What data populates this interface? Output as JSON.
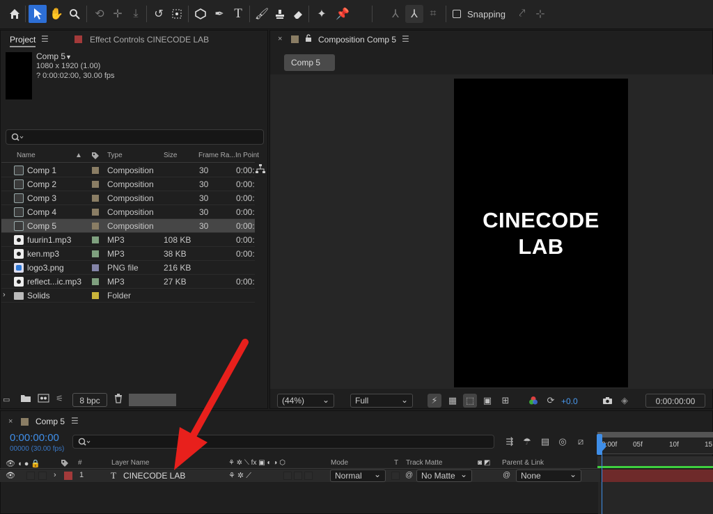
{
  "toolbar": {
    "snapping_label": "Snapping",
    "icons": [
      "home-icon",
      "selection-tool-icon",
      "hand-tool-icon",
      "zoom-tool-icon",
      "orbit-camera-icon",
      "pan-camera-icon",
      "dolly-camera-icon",
      "rotate-tool-icon",
      "pan-behind-icon",
      "shape-tool-icon",
      "pen-tool-icon",
      "type-tool-icon",
      "brush-tool-icon",
      "clone-stamp-icon",
      "eraser-icon",
      "roto-brush-icon",
      "puppet-pin-icon"
    ]
  },
  "project_panel": {
    "tab_label": "Project",
    "effect_controls_label": "Effect Controls CINECODE LAB",
    "preview": {
      "name": "Comp 5",
      "dimensions": "1080 x 1920 (1.00)",
      "duration": "? 0:00:02:00, 30.00 fps"
    },
    "search_placeholder": "",
    "columns": {
      "name": "Name",
      "type": "Type",
      "size": "Size",
      "frame_rate": "Frame Ra...",
      "in_point": "In Point"
    },
    "items": [
      {
        "name": "Comp 1",
        "type": "Composition",
        "size": "",
        "fps": "30",
        "in": "0:00:",
        "icon": "comp",
        "color": "#8a7d64"
      },
      {
        "name": "Comp 2",
        "type": "Composition",
        "size": "",
        "fps": "30",
        "in": "0:00:",
        "icon": "comp",
        "color": "#8a7d64"
      },
      {
        "name": "Comp 3",
        "type": "Composition",
        "size": "",
        "fps": "30",
        "in": "0:00:",
        "icon": "comp",
        "color": "#8a7d64"
      },
      {
        "name": "Comp 4",
        "type": "Composition",
        "size": "",
        "fps": "30",
        "in": "0:00:",
        "icon": "comp",
        "color": "#8a7d64"
      },
      {
        "name": "Comp 5",
        "type": "Composition",
        "size": "",
        "fps": "30",
        "in": "0:00:",
        "icon": "comp",
        "color": "#8a7d64",
        "selected": true
      },
      {
        "name": "fuurin1.mp3",
        "type": "MP3",
        "size": "108 KB",
        "fps": "",
        "in": "0:00:",
        "icon": "audio",
        "color": "#7fa07f"
      },
      {
        "name": "ken.mp3",
        "type": "MP3",
        "size": "38 KB",
        "fps": "",
        "in": "0:00:",
        "icon": "audio",
        "color": "#7fa07f"
      },
      {
        "name": "logo3.png",
        "type": "PNG file",
        "size": "216 KB",
        "fps": "",
        "in": "",
        "icon": "img",
        "color": "#8484a8"
      },
      {
        "name": "reflect...ic.mp3",
        "type": "MP3",
        "size": "27 KB",
        "fps": "",
        "in": "0:00:",
        "icon": "audio",
        "color": "#7fa07f"
      },
      {
        "name": "Solids",
        "type": "Folder",
        "size": "",
        "fps": "",
        "in": "",
        "icon": "folder",
        "color": "#c9b43a"
      }
    ],
    "bpc_label": "8 bpc"
  },
  "composition_panel": {
    "tab_label": "Composition Comp 5",
    "flow_tab": "Comp 5",
    "canvas_text_line1": "CINECODE",
    "canvas_text_line2": "LAB",
    "zoom": "(44%)",
    "resolution": "Full",
    "exposure": "+0.0",
    "timecode": "0:00:00:00"
  },
  "timeline_panel": {
    "tab_label": "Comp 5",
    "timecode": "0:00:00:00",
    "frames_fps": "00000 (30.00 fps)",
    "columns": {
      "num": "#",
      "layer_name": "Layer Name",
      "mode": "Mode",
      "t": "T",
      "track_matte": "Track Matte",
      "parent_link": "Parent & Link"
    },
    "ruler": [
      "0:00f",
      "05f",
      "10f",
      "15"
    ],
    "layers": [
      {
        "num": "1",
        "name": "CINECODE LAB",
        "mode": "Normal",
        "matte": "No Matte",
        "parent": "None",
        "label_color": "#a33a3a"
      }
    ]
  },
  "annotation": {
    "arrow_color": "#e8201c"
  }
}
